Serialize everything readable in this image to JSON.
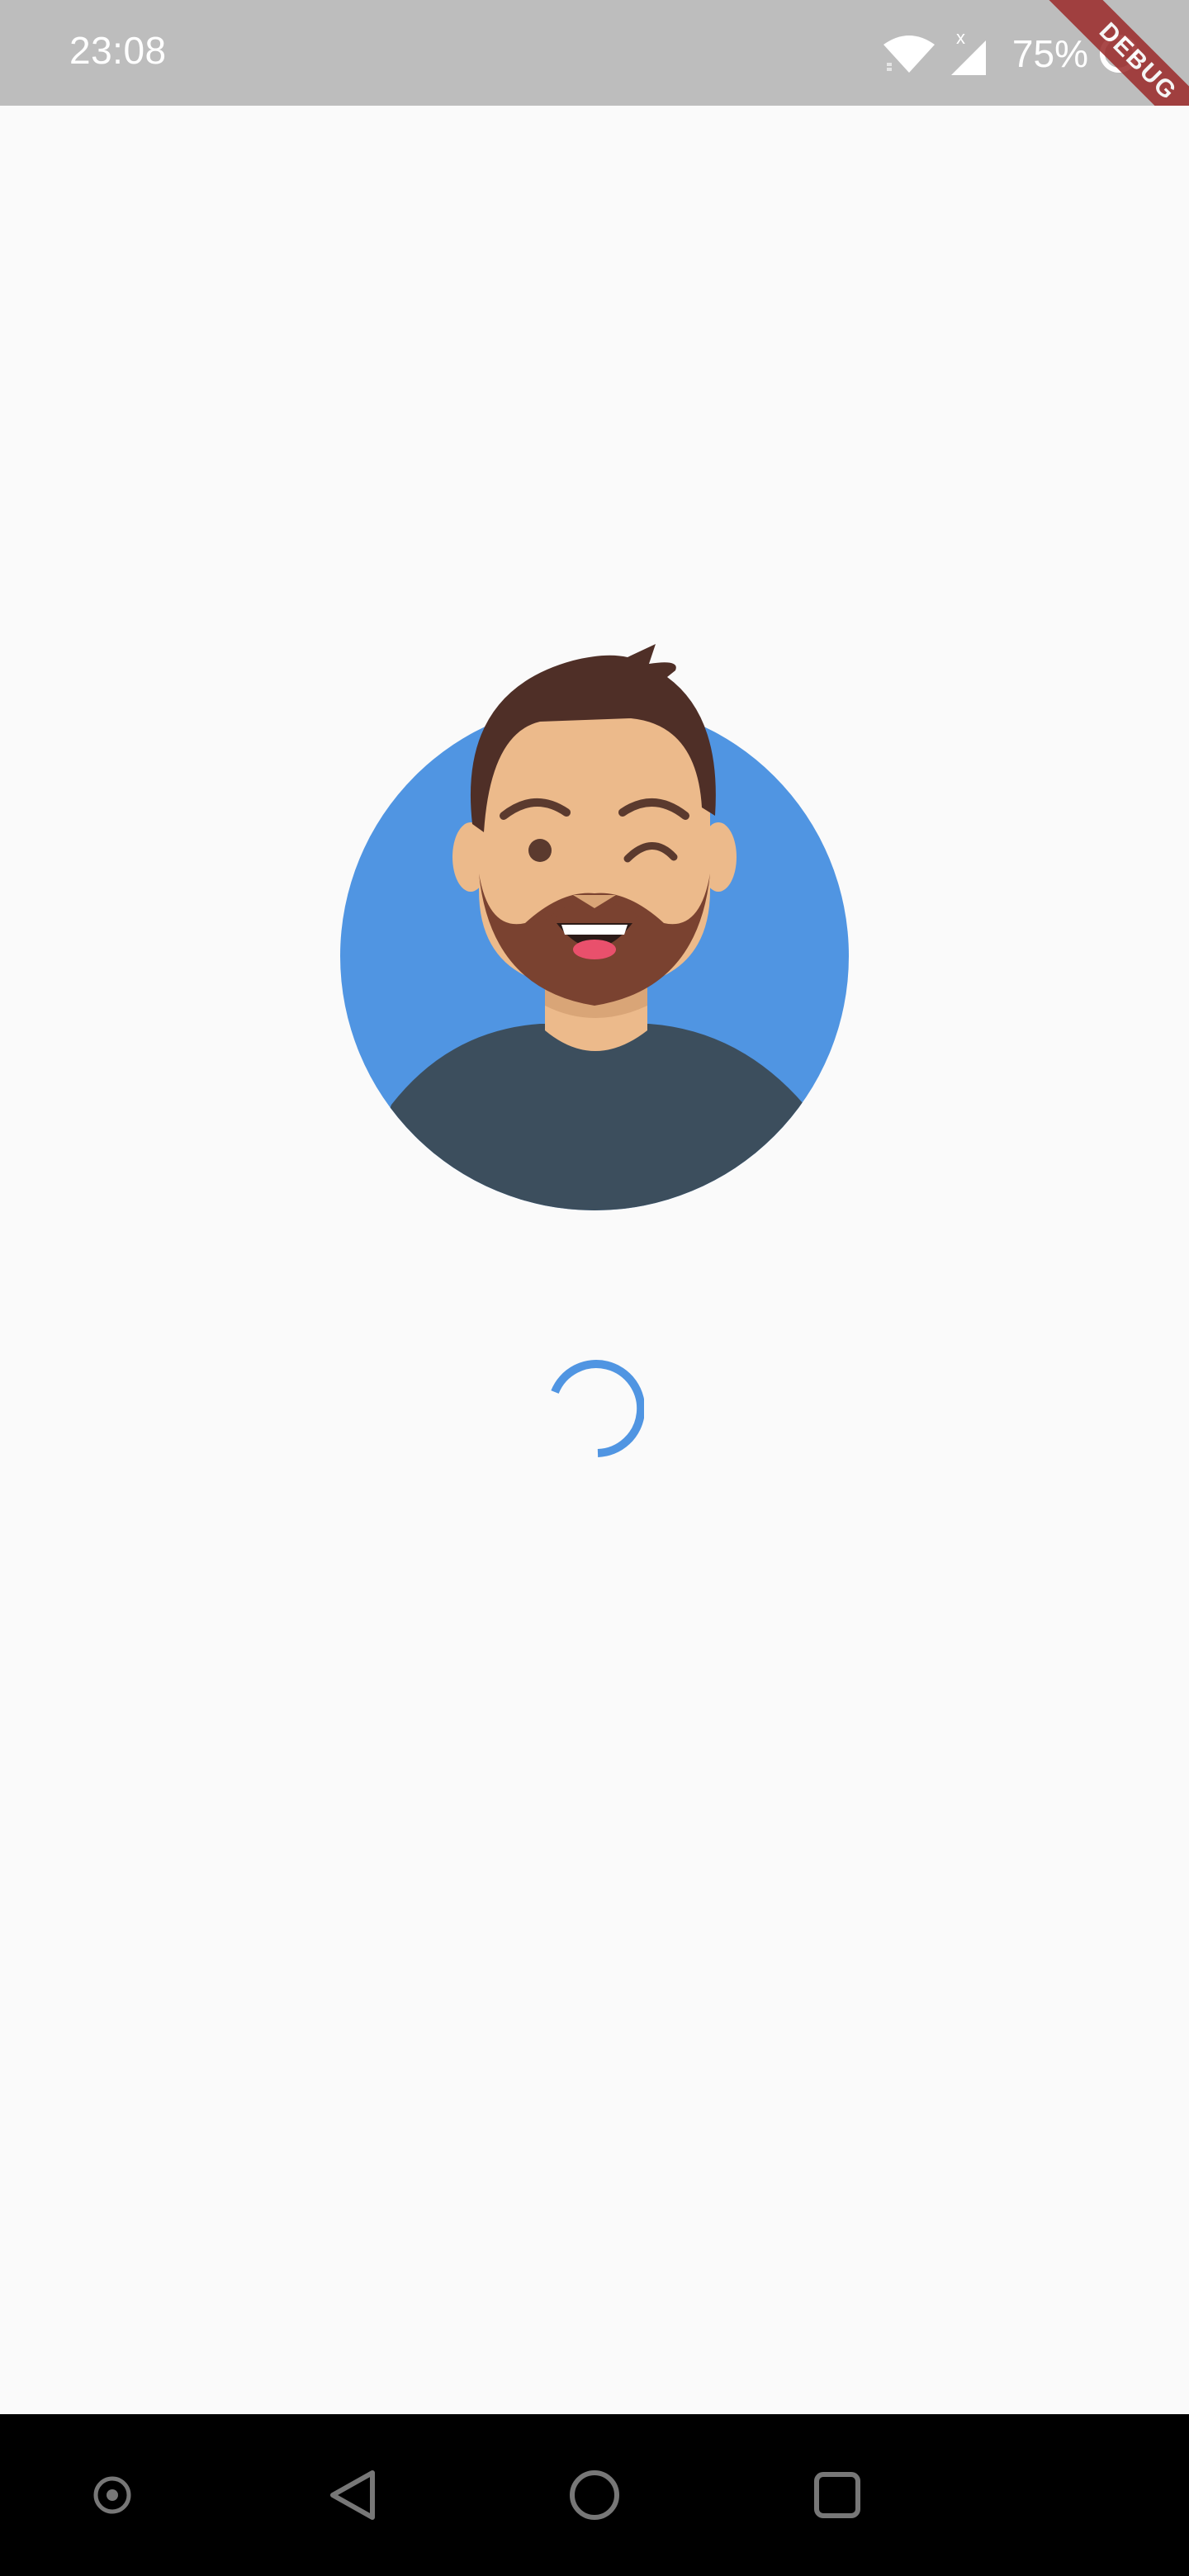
{
  "status_bar": {
    "time": "23:08",
    "battery_percent": "75%",
    "icons": [
      "wifi-icon",
      "signal-icon",
      "battery-icon"
    ]
  },
  "debug_banner": {
    "label": "DEBUG"
  },
  "loading": {
    "avatar": "avatar-illustration",
    "spinner": "progress-spinner",
    "accent_color": "#5095e2"
  },
  "nav_bar": {
    "buttons": [
      "home-dot-icon",
      "back-icon",
      "home-icon",
      "recents-icon"
    ]
  }
}
